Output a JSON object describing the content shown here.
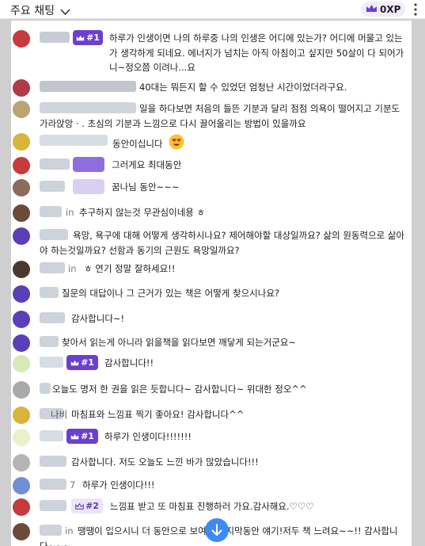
{
  "header": {
    "title": "주요 채팅",
    "xp_label": "0XP",
    "accent": "#6b3fd0"
  },
  "messages": [
    {
      "badge": "#1",
      "text": "하루가 인생이면 나의 하루중 나의 인생은 어디에 있는가? 어디에 머물고 있는가 생각하게 되네요. 에너지가 넘치는 아직 아침이고 싶지만 50살이 다 되어가니~정오쯤 이려나...요"
    },
    {
      "text": "40대는 뭐든지 할 수 있었던 엄청난 시간이었더라구요."
    },
    {
      "text": "일을 하다보면 처음의 들뜬 기분과 달리 점점 의욕이 떨어지고 기분도 가라앉앙 · . 초심의 기분과 느낌으로 다시 끌어올리는 방법이 있을까요"
    },
    {
      "text": "동안이십니다",
      "emoji": "heart-eyes"
    },
    {
      "text": "그러게요 최대동안"
    },
    {
      "text": "꿈나님 동안~~~"
    },
    {
      "name_suffix": "in",
      "text": "추구하지 않는것 무관심이네용 ㅎ"
    },
    {
      "text": "욕망, 욕구에 대해 어떻게 생각하시나요? 제어해야할 대상일까요? 삶의 원동력으로 삶아야 하는것일까요? 선함과 동기의 근원도 욕망일까요?"
    },
    {
      "name_suffix": "in",
      "text": "ㅎ 연기 정말 잘하세요!!"
    },
    {
      "text": "질문의 대답이나 그 근거가 있는 책은 어떻게 찾으시나요?"
    },
    {
      "text": "감사합니다~!"
    },
    {
      "text": "찾아서 읽는게 아니라 읽을책을 읽다보면 깨닿게 되는거군요~"
    },
    {
      "badge": "#1",
      "text": "감사합니다!!"
    },
    {
      "text": "오늘도 명저 한 권을 읽은 듯합니다~ 감사합니다~ 위대한 정오^^"
    },
    {
      "name_suffix": "나비",
      "text": "마침표와 느낌표 찍기 좋아요! 감사합니다^^"
    },
    {
      "badge": "#1",
      "text": "하루가 인생이다!!!!!!!"
    },
    {
      "text": "감사합니다. 저도 오늘도 느낀 바가 많았습니다!!!"
    },
    {
      "name_suffix": "7",
      "text": "하루가 인생이다!!!"
    },
    {
      "badge": "#2",
      "text": "느낌표 받고 또 마침표 진행하러 가요.감사해요.♡♡♡"
    },
    {
      "name_suffix": "in",
      "text": "땡땡이 입으시니 더 동안으로 보여요 마지막동안 얘기!저두 책 느려요~~!! 감사합니다~~~"
    }
  ]
}
